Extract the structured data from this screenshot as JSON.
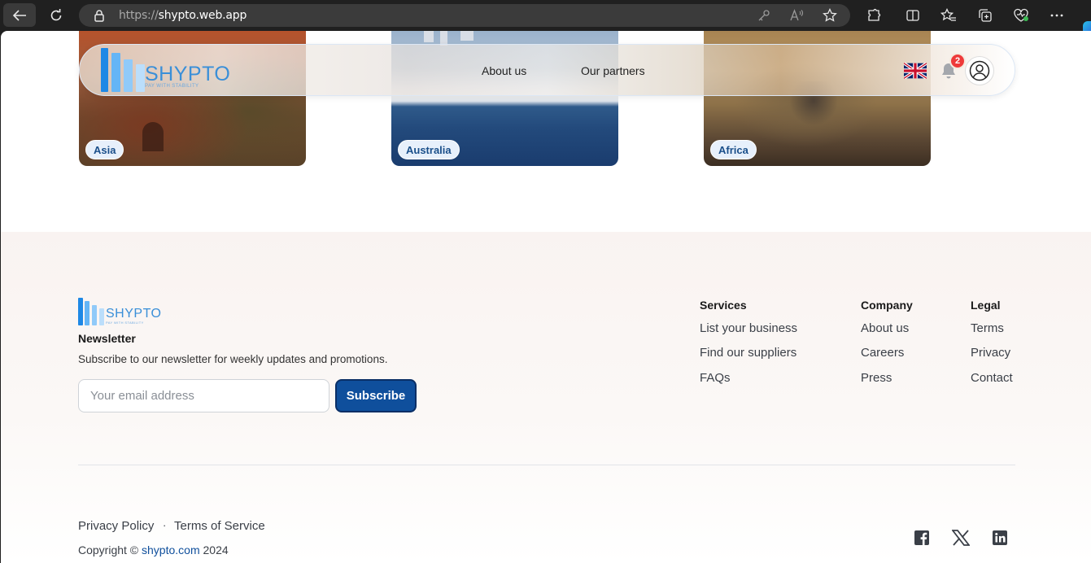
{
  "browser": {
    "url_prefix": "https://",
    "url_host": "shypto.web.app",
    "icons": [
      "back-icon",
      "reload-icon",
      "lock-icon",
      "key-icon",
      "read-aloud-icon",
      "favorite-star-icon",
      "extensions-icon",
      "split-screen-icon",
      "favorites-icon",
      "collections-icon",
      "browser-essentials-icon",
      "more-icon"
    ]
  },
  "header": {
    "logo_word": "SHYPTO",
    "logo_tagline": "PAY WITH STABILITY",
    "nav": [
      "About us",
      "Our partners"
    ],
    "notification_count": "2"
  },
  "regions": [
    {
      "label": "Asia"
    },
    {
      "label": "Australia"
    },
    {
      "label": "Africa"
    }
  ],
  "footer": {
    "logo_word": "SHYPTO",
    "logo_tagline": "PAY WITH STABILITY",
    "newsletter_title": "Newsletter",
    "newsletter_desc": "Subscribe to our newsletter for weekly updates and promotions.",
    "email_placeholder": "Your email address",
    "subscribe_label": "Subscribe",
    "columns": [
      {
        "title": "Services",
        "links": [
          "List your business",
          "Find our suppliers",
          "FAQs"
        ]
      },
      {
        "title": "Company",
        "links": [
          "About us",
          "Careers",
          "Press"
        ]
      },
      {
        "title": "Legal",
        "links": [
          "Terms",
          "Privacy",
          "Contact"
        ]
      }
    ],
    "privacy_policy": "Privacy Policy",
    "separator": "·",
    "terms_of_service": "Terms of Service",
    "copyright_prefix": "Copyright ©",
    "copyright_site": "shypto.com",
    "copyright_year": "2024",
    "social": [
      "facebook-icon",
      "x-icon",
      "linkedin-icon"
    ]
  },
  "colors": {
    "brand_blue": "#0f4f9c",
    "logo_blue": "#3a8fd8",
    "badge_text": "#1a4f8a",
    "notification_red": "#ee3a3a"
  }
}
